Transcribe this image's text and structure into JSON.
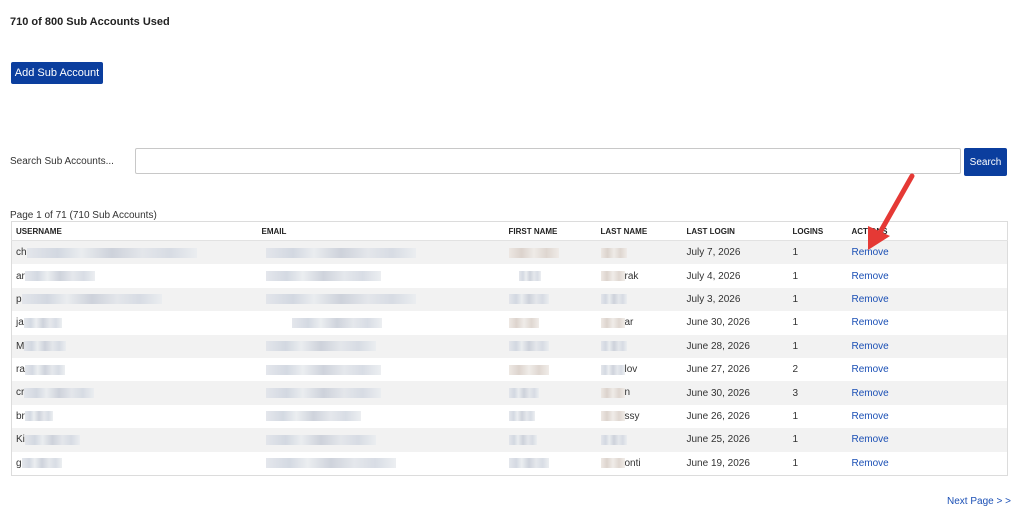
{
  "usage_text": "710 of 800 Sub Accounts Used",
  "add_button_label": "Add Sub Account",
  "search": {
    "label": "Search Sub Accounts...",
    "placeholder": "",
    "value": "",
    "button_label": "Search"
  },
  "page_info": "Page 1 of 71 (710 Sub Accounts)",
  "table": {
    "headers": {
      "username": "USERNAME",
      "email": "EMAIL",
      "first_name": "FIRST NAME",
      "last_name": "LAST NAME",
      "last_login": "LAST LOGIN",
      "logins": "LOGINS",
      "actions": "ACTIONS"
    },
    "rows": [
      {
        "username": "ch",
        "last_name": "",
        "last_login": "July 7, 2026",
        "logins": "1",
        "action": "Remove"
      },
      {
        "username": "ar",
        "last_name": "rak",
        "last_login": "July 4, 2026",
        "logins": "1",
        "action": "Remove"
      },
      {
        "username": "p",
        "last_name": "",
        "last_login": "July 3, 2026",
        "logins": "1",
        "action": "Remove"
      },
      {
        "username": "ja",
        "last_name": "ar",
        "last_login": "June 30, 2026",
        "logins": "1",
        "action": "Remove"
      },
      {
        "username": "M",
        "last_name": "",
        "last_login": "June 28, 2026",
        "logins": "1",
        "action": "Remove"
      },
      {
        "username": "ra",
        "last_name": "lov",
        "last_login": "June 27, 2026",
        "logins": "2",
        "action": "Remove"
      },
      {
        "username": "cr",
        "last_name": "n",
        "last_login": "June 30, 2026",
        "logins": "3",
        "action": "Remove"
      },
      {
        "username": "br",
        "last_name": "ssy",
        "last_login": "June 26, 2026",
        "logins": "1",
        "action": "Remove"
      },
      {
        "username": "Ki",
        "last_name": "",
        "last_login": "June 25, 2026",
        "logins": "1",
        "action": "Remove"
      },
      {
        "username": "g",
        "last_name": "onti",
        "last_login": "June 19, 2026",
        "logins": "1",
        "action": "Remove"
      }
    ]
  },
  "next_page_label": "Next Page > >",
  "colors": {
    "primary_button": "#0b3e9e",
    "link": "#1a4fb5",
    "annotation_arrow": "#e53935",
    "row_stripe": "#f2f2f2"
  },
  "annotation": {
    "icon": "red-arrow-icon",
    "points_to": "actions column header"
  }
}
